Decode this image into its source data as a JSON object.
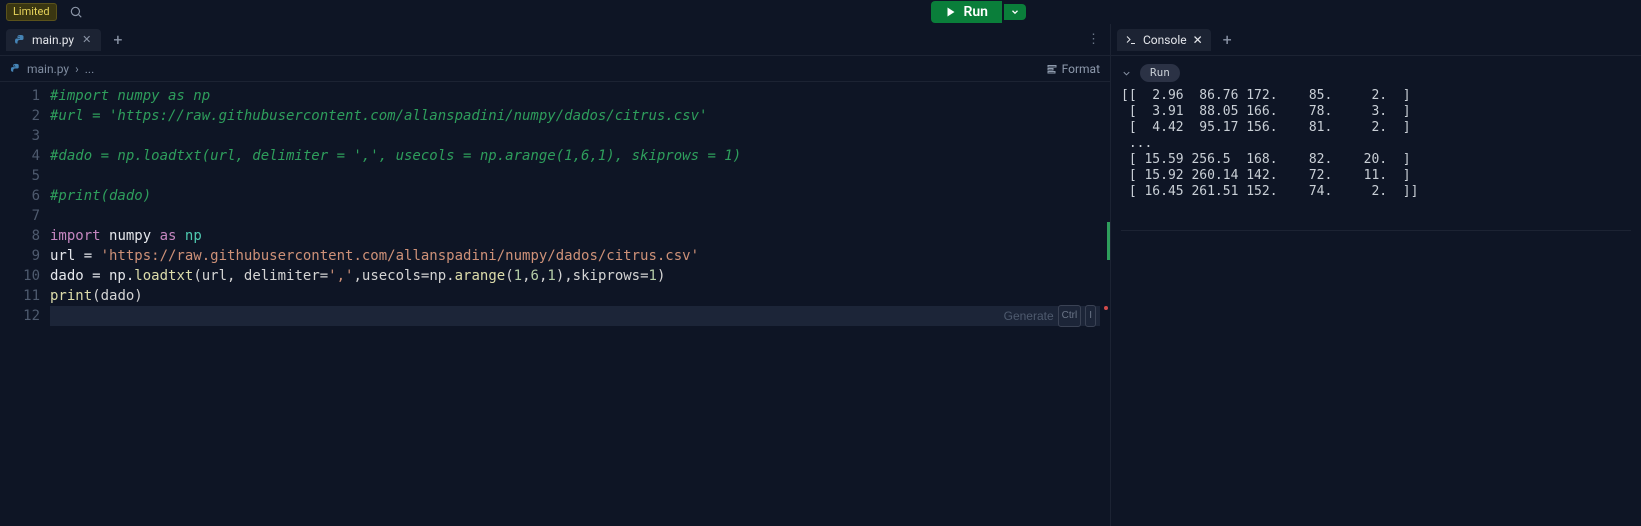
{
  "topbar": {
    "limited_label": "Limited",
    "run_label": "Run"
  },
  "editor": {
    "tab": {
      "filename": "main.py"
    },
    "breadcrumb": {
      "file": "main.py",
      "sep": "›",
      "ellipsis": "..."
    },
    "format_label": "Format",
    "generate_label": "Generate",
    "key1": "Ctrl",
    "key2": "I",
    "lines": {
      "l1": "#import numpy as np",
      "l2": "#url = 'https://raw.githubusercontent.com/allanspadini/numpy/dados/citrus.csv'",
      "l3": "",
      "l4": "#dado = np.loadtxt(url, delimiter = ',', usecols = np.arange(1,6,1), skiprows = 1)",
      "l5": "",
      "l6": "#print(dado)",
      "l7": "",
      "l8_import": "import",
      "l8_numpy": "numpy",
      "l8_as": "as",
      "l8_np": "np",
      "l9_pre": "url = ",
      "l9_str": "'https://raw.githubusercontent.com/allanspadini/numpy/dados/citrus.csv'",
      "l10_a": "dado = np.",
      "l10_loadtxt": "loadtxt",
      "l10_b": "(url, delimiter=",
      "l10_comma": "','",
      "l10_c": ",usecols=np.",
      "l10_arange": "arange",
      "l10_d": "(",
      "l10_n1": "1",
      "l10_n2": "6",
      "l10_n3": "1",
      "l10_e": "),skiprows=",
      "l10_n4": "1",
      "l10_f": ")",
      "l11_print": "print",
      "l11_rest": "(dado)",
      "gutter": [
        "1",
        "2",
        "3",
        "4",
        "5",
        "6",
        "7",
        "8",
        "9",
        "10",
        "11",
        "12"
      ]
    }
  },
  "console": {
    "tab_label": "Console",
    "run_chip": "Run",
    "output": "[[  2.96  86.76 172.    85.     2.  ]\n [  3.91  88.05 166.    78.     3.  ]\n [  4.42  95.17 156.    81.     2.  ]\n ...\n [ 15.59 256.5  168.    82.    20.  ]\n [ 15.92 260.14 142.    72.    11.  ]\n [ 16.45 261.51 152.    74.     2.  ]]"
  }
}
